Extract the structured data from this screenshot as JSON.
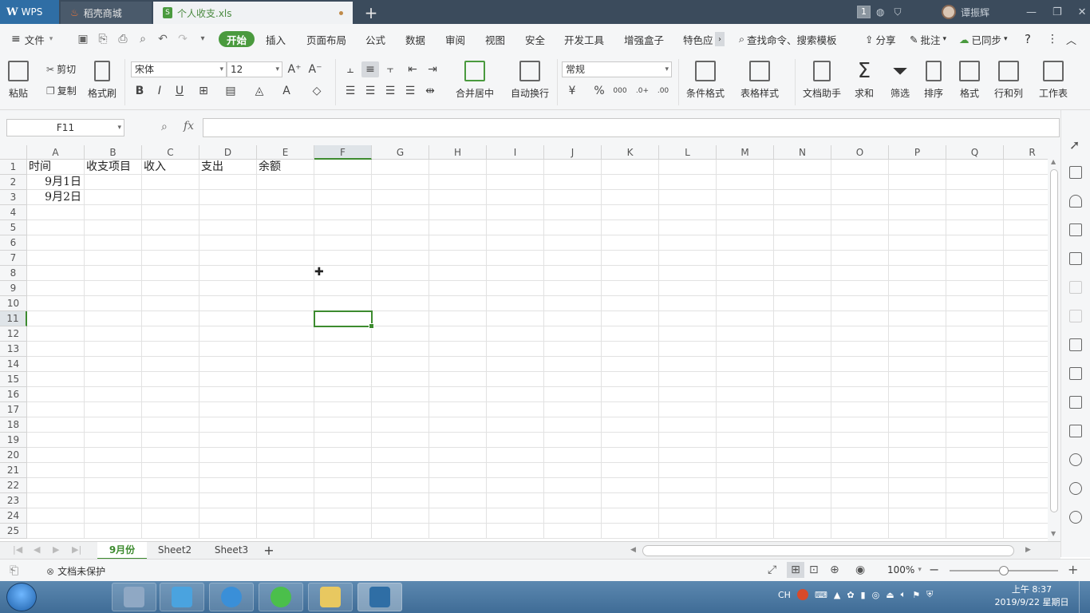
{
  "titlebar": {
    "tabs": [
      {
        "label": "WPS"
      },
      {
        "label": "稻壳商城"
      },
      {
        "label": "个人收支.xls"
      }
    ],
    "new_tab": "+",
    "badge": "1",
    "user": "谭振辉"
  },
  "menubar": {
    "file": "文件",
    "tabs": [
      "开始",
      "插入",
      "页面布局",
      "公式",
      "数据",
      "审阅",
      "视图",
      "安全",
      "开发工具",
      "增强盒子",
      "特色应"
    ],
    "search": "查找命令、搜索模板",
    "share": "分享",
    "comment": "批注",
    "sync": "已同步"
  },
  "ribbon": {
    "paste": "粘贴",
    "cut": "剪切",
    "copy": "复制",
    "format_painter": "格式刷",
    "font_name": "宋体",
    "font_size": "12",
    "merge_center": "合并居中",
    "wrap_text": "自动换行",
    "number_format": "常规",
    "cond_format": "条件格式",
    "table_style": "表格样式",
    "doc_assistant": "文档助手",
    "sum": "求和",
    "filter": "筛选",
    "sort": "排序",
    "format": "格式",
    "row_col": "行和列",
    "worksheet": "工作表"
  },
  "formulabar": {
    "name_box": "F11",
    "fx": "fx",
    "formula": ""
  },
  "grid": {
    "columns": [
      "A",
      "B",
      "C",
      "D",
      "E",
      "F",
      "G",
      "H",
      "I",
      "J",
      "K",
      "L",
      "M",
      "N",
      "O",
      "P",
      "Q",
      "R"
    ],
    "rows": [
      "1",
      "2",
      "3",
      "4",
      "5",
      "6",
      "7",
      "8",
      "9",
      "10",
      "11",
      "12",
      "13",
      "14",
      "15",
      "16",
      "17",
      "18",
      "19",
      "20",
      "21",
      "22",
      "23",
      "24",
      "25"
    ],
    "cells": {
      "A1": "时间",
      "B1": "收支项目",
      "C1": "收入",
      "D1": "支出",
      "E1": "余额",
      "A2": "9月1日",
      "A3": "9月2日"
    },
    "selected": "F11"
  },
  "sheets": {
    "tabs": [
      "9月份",
      "Sheet2",
      "Sheet3"
    ],
    "active": "9月份",
    "add": "+"
  },
  "statusbar": {
    "protect": "文档未保护",
    "zoom": "100%",
    "zoom_fraction": 0.5
  },
  "taskbar": {
    "tray_lang": "CH",
    "time": "上午 8:37",
    "date": "2019/9/22 星期日"
  },
  "colors": {
    "accent": "#4a9a3e",
    "titlebar": "#3b4b5c",
    "taskbar": "#3f6c96"
  }
}
